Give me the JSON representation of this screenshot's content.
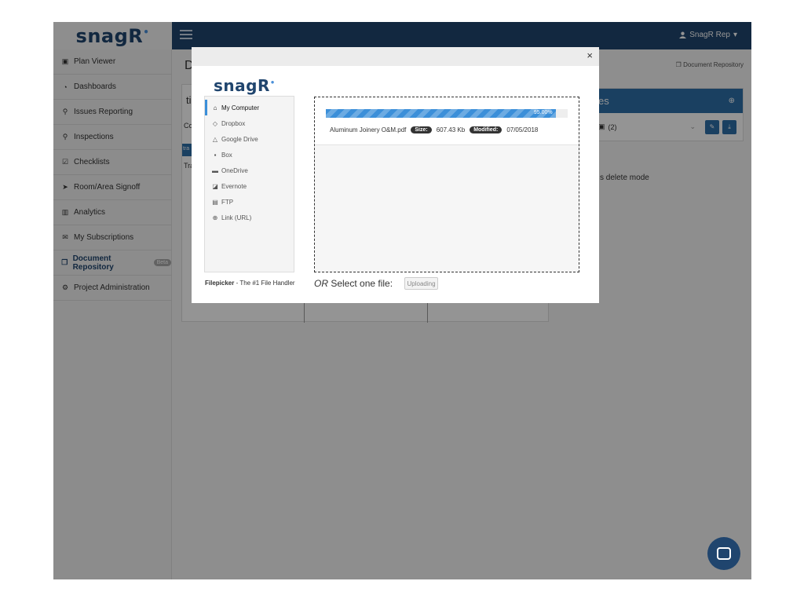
{
  "brand": {
    "logo_text": "snag",
    "logo_r": "R",
    "logo_dot": "•"
  },
  "topbar": {
    "user_label": "SnagR Rep",
    "user_icon": "user-icon",
    "caret": "▾"
  },
  "sidebar": {
    "items": [
      {
        "label": "Plan Viewer",
        "icon": "image-icon",
        "glyph": "▣"
      },
      {
        "label": "Dashboards",
        "icon": "dashboard-icon",
        "glyph": "◔"
      },
      {
        "label": "Issues Reporting",
        "icon": "map-marker-icon",
        "glyph": "⚲"
      },
      {
        "label": "Inspections",
        "icon": "search-icon",
        "glyph": "⚲"
      },
      {
        "label": "Checklists",
        "icon": "checkbox-icon",
        "glyph": "☑"
      },
      {
        "label": "Room/Area Signoff",
        "icon": "send-icon",
        "glyph": "➤"
      },
      {
        "label": "Analytics",
        "icon": "bar-chart-icon",
        "glyph": "▥"
      },
      {
        "label": "My Subscriptions",
        "icon": "envelope-icon",
        "glyph": "✉"
      },
      {
        "label": "Document Repository",
        "icon": "copy-icon",
        "glyph": "❐",
        "badge": "Beta"
      },
      {
        "label": "Project Administration",
        "icon": "cogs-icon",
        "glyph": "⚙"
      }
    ]
  },
  "main": {
    "title_fragment": "D",
    "breadcrumb": "Document Repository",
    "left_frags": [
      "ti",
      "Co",
      "tra",
      "Tra"
    ],
    "right_panel": {
      "title_fragment": "es",
      "row_fragment": "(2)"
    },
    "delete_mode_text": "s delete mode"
  },
  "modal": {
    "close": "×",
    "logo_text": "snag",
    "logo_r": "R",
    "sources": [
      {
        "label": "My Computer",
        "icon": "home-icon",
        "glyph": "⌂",
        "active": true
      },
      {
        "label": "Dropbox",
        "icon": "dropbox-icon",
        "glyph": "◇"
      },
      {
        "label": "Google Drive",
        "icon": "google-drive-icon",
        "glyph": "△"
      },
      {
        "label": "Box",
        "icon": "box-icon",
        "glyph": "▪"
      },
      {
        "label": "OneDrive",
        "icon": "onedrive-icon",
        "glyph": "▬"
      },
      {
        "label": "Evernote",
        "icon": "evernote-icon",
        "glyph": "◪"
      },
      {
        "label": "FTP",
        "icon": "ftp-icon",
        "glyph": "▤"
      },
      {
        "label": "Link (URL)",
        "icon": "link-icon",
        "glyph": "⊕"
      }
    ],
    "footer_brand": "Filepicker",
    "footer_tagline": " - The #1 File Handler",
    "upload": {
      "progress_percent": 95,
      "progress_text": "95.00%",
      "file_name": "Aluminum Joinery O&M.pdf",
      "size_label": "Size:",
      "size_value": "607.43 Kb",
      "modified_label": "Modified:",
      "modified_value": "07/05/2018"
    },
    "or_text": "OR",
    "select_text": " Select one file:",
    "upload_button": "Uploading"
  },
  "colors": {
    "navbar": "#20456e",
    "accent": "#3b8fd9",
    "panel_blue": "#2d6ea8"
  }
}
